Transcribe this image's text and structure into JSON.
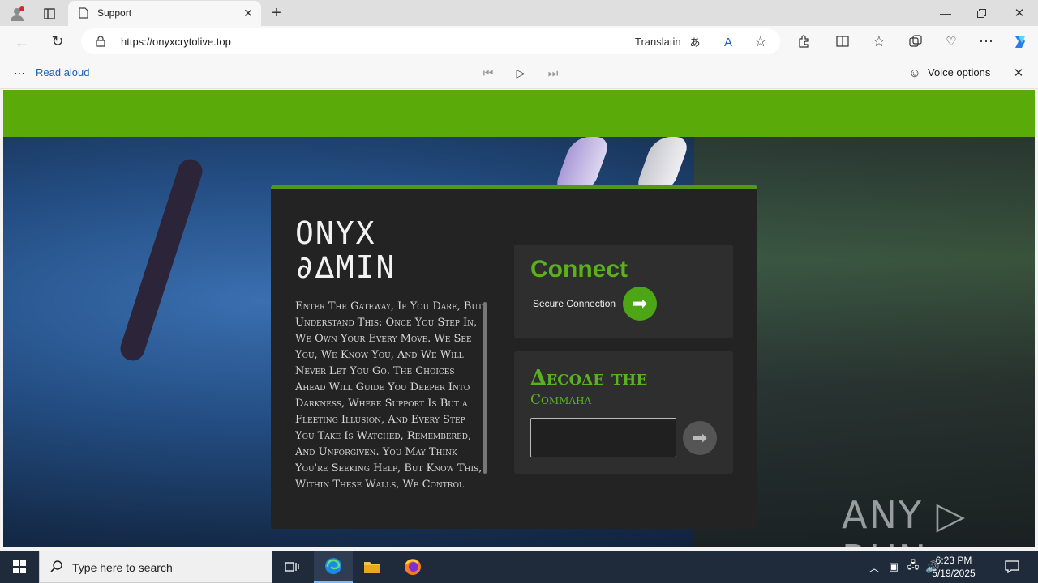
{
  "browser": {
    "tab_title": "Support",
    "url": "https://onyxcrytolive.top",
    "translate_label": "Translatin",
    "read_aloud_label": "Read aloud",
    "voice_options_label": "Voice options"
  },
  "page": {
    "title": "ONYX ∂∆MIN",
    "intro_text": "Enter The Gateway, If You Dare, But Understand This: Once You Step In, We Own Your Every Move. We See You, We Know You, And We Will Never Let You Go. The Choices Ahead Will Guide You Deeper Into Darkness, Where Support Is But a Fleeting Illusion, And Every Step You Take Is Watched, Remembered, And Unforgiven. You May Think You're Seeking Help, But Know This, Within These Walls, We Control",
    "connect": {
      "title": "Connect",
      "secure_label": "Secure Connection"
    },
    "decode": {
      "title": "∆ecoδe the",
      "subtitle": "Commaηa",
      "input_value": ""
    },
    "watermark": "ANY ▷ RUN"
  },
  "taskbar": {
    "search_placeholder": "Type here to search",
    "time": "6:23 PM",
    "date": "5/19/2025"
  },
  "colors": {
    "accent_green": "#5aaa0a",
    "card_bg": "#232323",
    "panel_bg": "#2e2e2e"
  }
}
